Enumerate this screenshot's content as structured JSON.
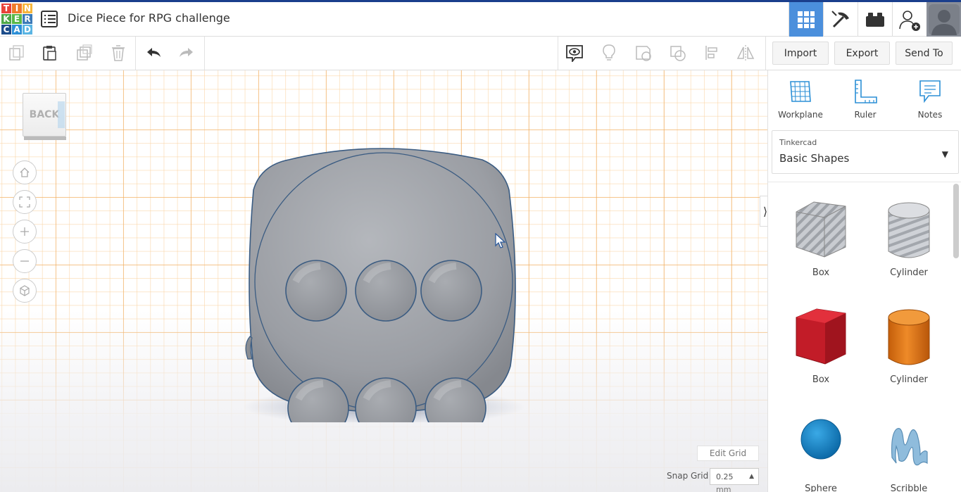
{
  "app": {
    "logo_letters": [
      "T",
      "I",
      "N",
      "K",
      "E",
      "R",
      "C",
      "A",
      "D"
    ],
    "logo_colors": [
      "#e8433a",
      "#ef7b2a",
      "#f6b63c",
      "#4da747",
      "#58b848",
      "#3c7ab8",
      "#1d4d8b",
      "#2d8fd6",
      "#5bb5e3"
    ],
    "title": "Dice Piece for RPG challenge"
  },
  "topbar": {
    "icons": [
      "grid-view-icon",
      "pickaxe-icon",
      "bricks-icon",
      "add-user-icon",
      "avatar"
    ],
    "active_color": "#4b8fdc"
  },
  "toolbar": {
    "import_label": "Import",
    "export_label": "Export",
    "send_to_label": "Send To"
  },
  "workspace": {
    "viewcube_label": "BACK",
    "edit_grid_label": "Edit Grid",
    "snap_grid_label": "Snap Grid",
    "snap_grid_value": "0.25",
    "snap_grid_unit": "mm"
  },
  "panel": {
    "tools": [
      {
        "label": "Workplane",
        "icon": "workplane-icon"
      },
      {
        "label": "Ruler",
        "icon": "ruler-icon"
      },
      {
        "label": "Notes",
        "icon": "notes-icon"
      }
    ],
    "library_source": "Tinkercad",
    "library_name": "Basic Shapes",
    "shapes": [
      {
        "label": "Box",
        "kind": "hole"
      },
      {
        "label": "Cylinder",
        "kind": "hole"
      },
      {
        "label": "Box",
        "kind": "solid",
        "color": "#d01f2a"
      },
      {
        "label": "Cylinder",
        "kind": "solid",
        "color": "#e57a1a"
      },
      {
        "label": "Sphere",
        "kind": "solid",
        "color": "#1a8fd0"
      },
      {
        "label": "Scribble",
        "kind": "solid",
        "color": "#8ab8d8"
      }
    ]
  }
}
